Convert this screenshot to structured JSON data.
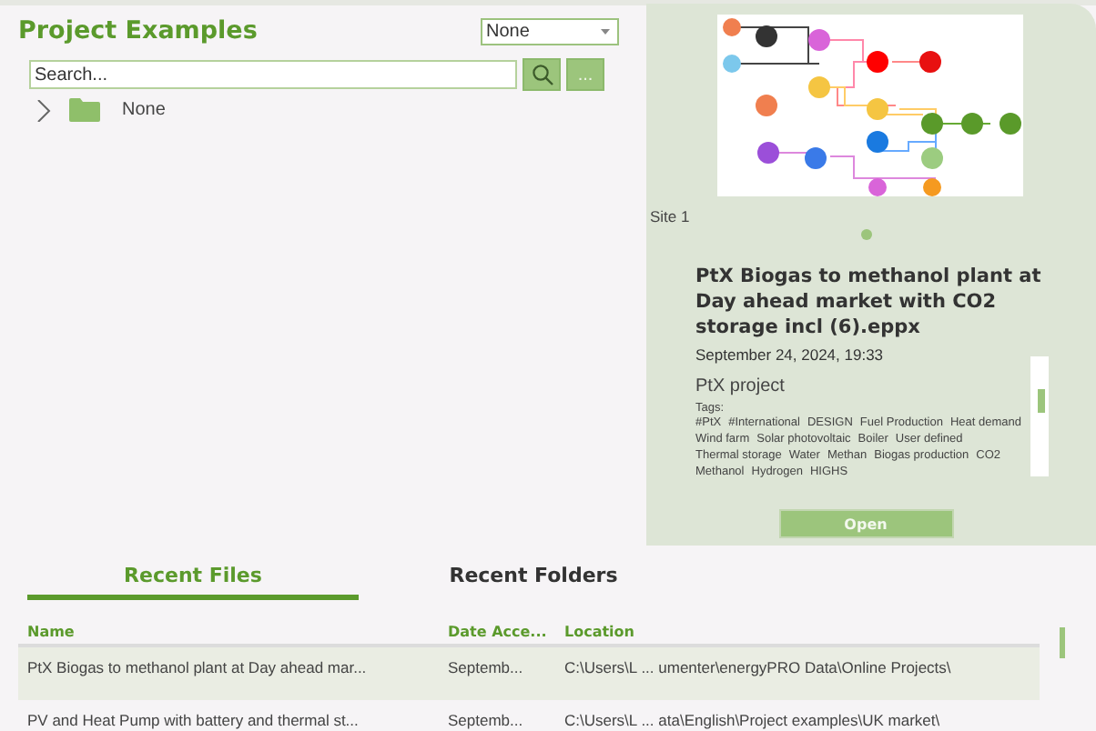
{
  "project_panel": {
    "title": "Project Examples",
    "filter": {
      "value": "None"
    },
    "search": {
      "placeholder": "Search..."
    },
    "more_button": "...",
    "tree": [
      {
        "label": "None",
        "expanded": false
      }
    ]
  },
  "preview": {
    "site_label": "Site 1",
    "pages": [
      {
        "selected": true
      }
    ],
    "title": "PtX Biogas to methanol plant at Day ahead market with CO2 storage incl (6).eppx",
    "date": "September 24, 2024, 19:33",
    "description": "PtX project",
    "tags_label": "Tags:",
    "tags": [
      "#PtX",
      "#International",
      "DESIGN",
      "Fuel Production",
      "Heat demand",
      "Wind farm",
      "Solar photovoltaic",
      "Boiler",
      "User defined",
      "Thermal storage",
      "Water",
      "Methan",
      "Biogas production",
      "CO2",
      "Methanol",
      "Hydrogen",
      "HIGHS"
    ],
    "open_button": "Open"
  },
  "tabs": [
    {
      "label": "Recent Files",
      "selected": true
    },
    {
      "label": "Recent Folders",
      "selected": false
    }
  ],
  "table": {
    "columns": [
      "Name",
      "Date Acce...",
      "Location"
    ],
    "rows": [
      {
        "cells": [
          "PtX Biogas to methanol plant at Day ahead mar...",
          "Septemb...",
          "C:\\Users\\L ... umenter\\energyPRO Data\\Online Projects\\"
        ],
        "selected": true
      },
      {
        "cells": [
          "PV and Heat Pump with battery and thermal st...",
          "Septemb...",
          "C:\\Users\\L ... ata\\English\\Project examples\\UK market\\"
        ],
        "selected": false
      }
    ]
  }
}
